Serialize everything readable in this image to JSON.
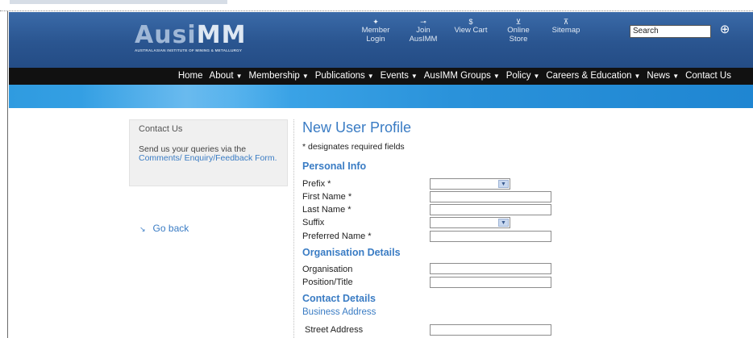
{
  "header": {
    "logo_main": "Ausi",
    "logo_accent": "MM",
    "logo_sub": "AUSTRALASIAN INSTITUTE OF MINING & METALLURGY",
    "toplinks": [
      {
        "icon": "✦",
        "label": "Member Login"
      },
      {
        "icon": "⊸",
        "label": "Join AusIMM"
      },
      {
        "icon": "$",
        "label": "View Cart"
      },
      {
        "icon": "⊻",
        "label": "Online Store"
      },
      {
        "icon": "⊼",
        "label": "Sitemap"
      }
    ],
    "search_placeholder": "Search",
    "search_go_icon": "⊕"
  },
  "nav": {
    "items": [
      {
        "label": "Home",
        "dropdown": false
      },
      {
        "label": "About",
        "dropdown": true
      },
      {
        "label": "Membership",
        "dropdown": true
      },
      {
        "label": "Publications",
        "dropdown": true
      },
      {
        "label": "Events",
        "dropdown": true
      },
      {
        "label": "AusIMM Groups",
        "dropdown": true
      },
      {
        "label": "Policy",
        "dropdown": true
      },
      {
        "label": "Careers & Education",
        "dropdown": true
      },
      {
        "label": "News",
        "dropdown": true
      },
      {
        "label": "Contact Us",
        "dropdown": false
      }
    ]
  },
  "sidebar": {
    "title": "Contact Us",
    "text_prefix": "Send us your queries via the ",
    "link_text": "Comments/ Enquiry/Feedback Form.",
    "go_back": "Go back"
  },
  "form": {
    "title": "New User Profile",
    "required_note": "* designates required fields",
    "sections": {
      "personal": "Personal Info",
      "organisation": "Organisation Details",
      "contact": "Contact Details",
      "business_address": "Business Address"
    },
    "fields": {
      "prefix": "Prefix *",
      "first_name": "First Name *",
      "last_name": "Last Name *",
      "suffix": "Suffix",
      "preferred_name": "Preferred Name *",
      "organisation": "Organisation",
      "position_title": "Position/Title",
      "street_address": "Street Address"
    }
  },
  "colors": {
    "header_blue": "#2a5590",
    "nav_black": "#111111",
    "band_blue": "#2f9be0",
    "link_blue": "#3a7cc4"
  }
}
